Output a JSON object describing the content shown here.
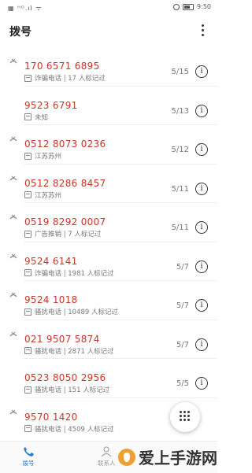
{
  "status_bar": {
    "left": "▦ ᵸᴳ.ıl ᯤ",
    "time": "9:50"
  },
  "header": {
    "title": "拨号"
  },
  "calls": [
    {
      "number": "170 6571 6895",
      "label": "诈骗电话 | 17 人标记过",
      "date": "5/15"
    },
    {
      "number": "9523 6791",
      "label": "未知",
      "date": "5/13"
    },
    {
      "number": "0512 8073 0236",
      "label": "江苏苏州",
      "date": "5/12"
    },
    {
      "number": "0512 8286 8457",
      "label": "江苏苏州",
      "date": "5/11"
    },
    {
      "number": "0519 8292 0007",
      "label": "广告推销 | 7 人标记过",
      "date": "5/11"
    },
    {
      "number": "9524 6141",
      "label": "诈骗电话 | 1981 人标记过",
      "date": "5/7"
    },
    {
      "number": "9524 1018",
      "label": "骚扰电话 | 10489 人标记过",
      "date": "5/7"
    },
    {
      "number": "021 9507 5874",
      "label": "骚扰电话 | 2871 人标记过",
      "date": "5/7"
    },
    {
      "number": "0523 8050 2956",
      "label": "骚扰电话 | 151 人标记过",
      "date": "5/5"
    },
    {
      "number": "9570 1420",
      "label": "骚扰电话 | 4509 人标记过",
      "date": ""
    }
  ],
  "nav": {
    "dial": "拨号",
    "contacts": "联系人"
  },
  "watermark": {
    "text": "爱上手游网"
  },
  "colors": {
    "number": "#c0392b",
    "accent": "#2a7bd6"
  }
}
